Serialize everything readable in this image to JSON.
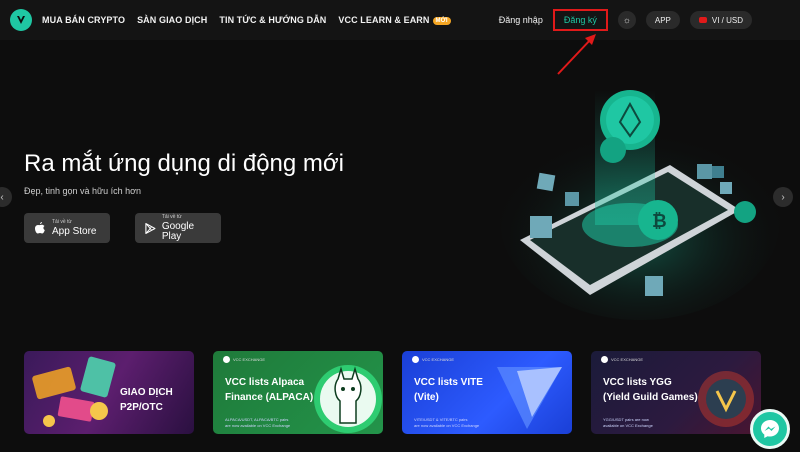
{
  "nav": {
    "links": [
      "MUA BÁN CRYPTO",
      "SÀN GIAO DỊCH",
      "TIN TỨC & HƯỚNG DẪN",
      "VCC LEARN & EARN"
    ],
    "new_badge": "MỚI",
    "login": "Đăng nhập",
    "signup": "Đăng ký",
    "app": "APP",
    "locale": "VI / USD"
  },
  "hero": {
    "title": "Ra mắt ứng dụng di động mới",
    "subtitle": "Đẹp, tinh gọn và hữu ích hơn",
    "app_store_small": "Tải về từ",
    "app_store": "App Store",
    "google_play_small": "Tải về từ",
    "google_play": "Google Play"
  },
  "cards": [
    {
      "title_line1": "GIAO DỊCH",
      "title_line2": "P2P/OTC",
      "mini": "",
      "desc1": "",
      "desc2": ""
    },
    {
      "title_line1": "VCC lists Alpaca",
      "title_line2": "Finance (ALPACA)",
      "mini": "VCC EXCHANGE",
      "desc1": "ALPACA/USDT, ALPACA/BTC pairs",
      "desc2": "are now available on VCC Exchange"
    },
    {
      "title_line1": "VCC lists VITE",
      "title_line2": "(Vite)",
      "mini": "VCC EXCHANGE",
      "desc1": "VITE/USDT & VITE/BTC pairs",
      "desc2": "are now available on VCC Exchange"
    },
    {
      "title_line1": "VCC lists YGG",
      "title_line2": "(Yield Guild Games)",
      "mini": "VCC EXCHANGE",
      "desc1": "YGG/USDT pairs are now",
      "desc2": "available on VCC Exchange"
    }
  ],
  "colors": {
    "accent": "#1fc7a3",
    "highlight": "#e11a1a",
    "badge": "#f5a623"
  }
}
